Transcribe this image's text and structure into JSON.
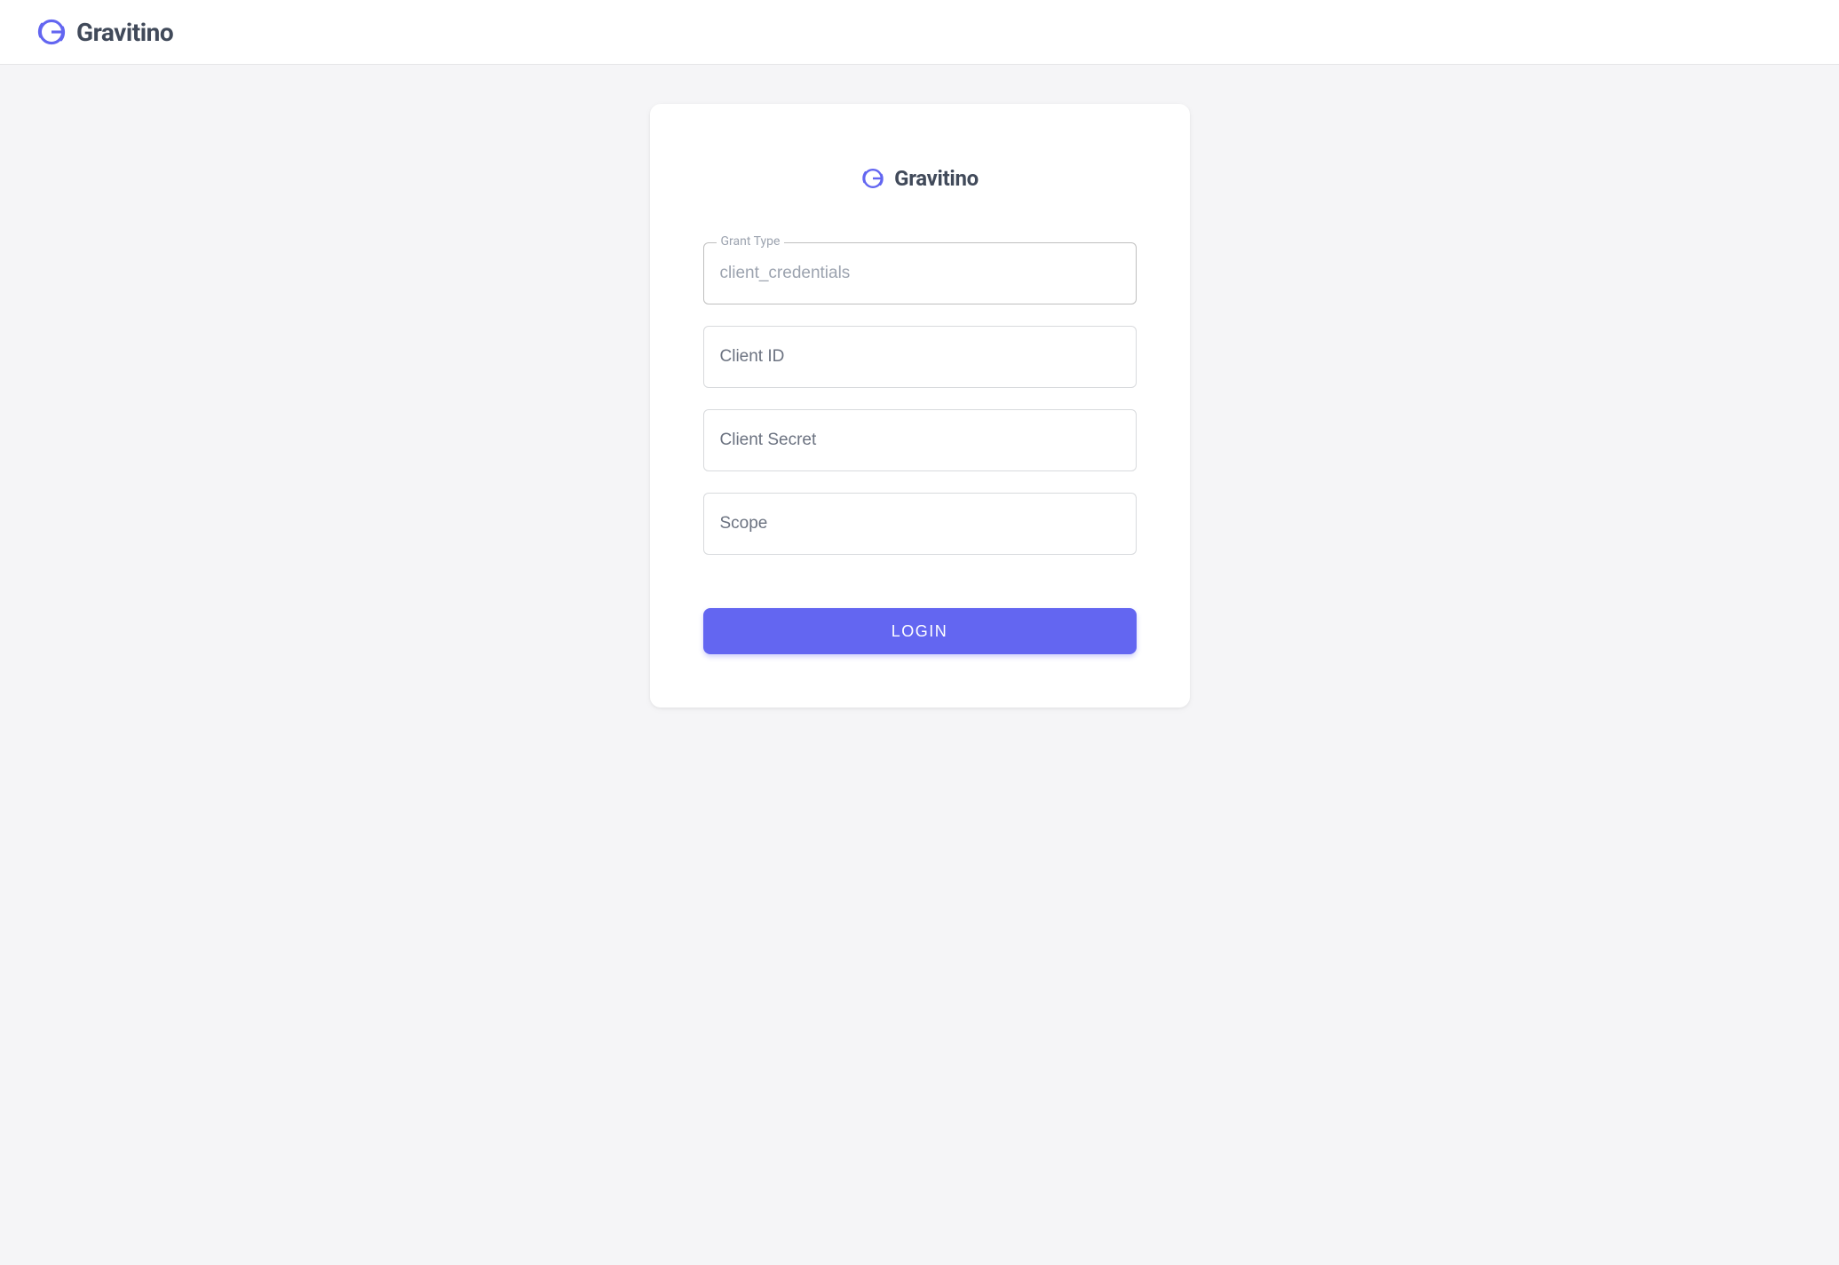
{
  "header": {
    "brand": "Gravitino"
  },
  "card": {
    "brand": "Gravitino"
  },
  "form": {
    "grant_type": {
      "label": "Grant Type",
      "placeholder": "client_credentials",
      "value": ""
    },
    "client_id": {
      "placeholder": "Client ID",
      "value": ""
    },
    "client_secret": {
      "placeholder": "Client Secret",
      "value": ""
    },
    "scope": {
      "placeholder": "Scope",
      "value": ""
    },
    "login_button": "LOGIN"
  },
  "colors": {
    "accent": "#6366f1",
    "text_dark": "#414a5a",
    "placeholder": "#9ca3af",
    "border": "#bfbfbf"
  }
}
